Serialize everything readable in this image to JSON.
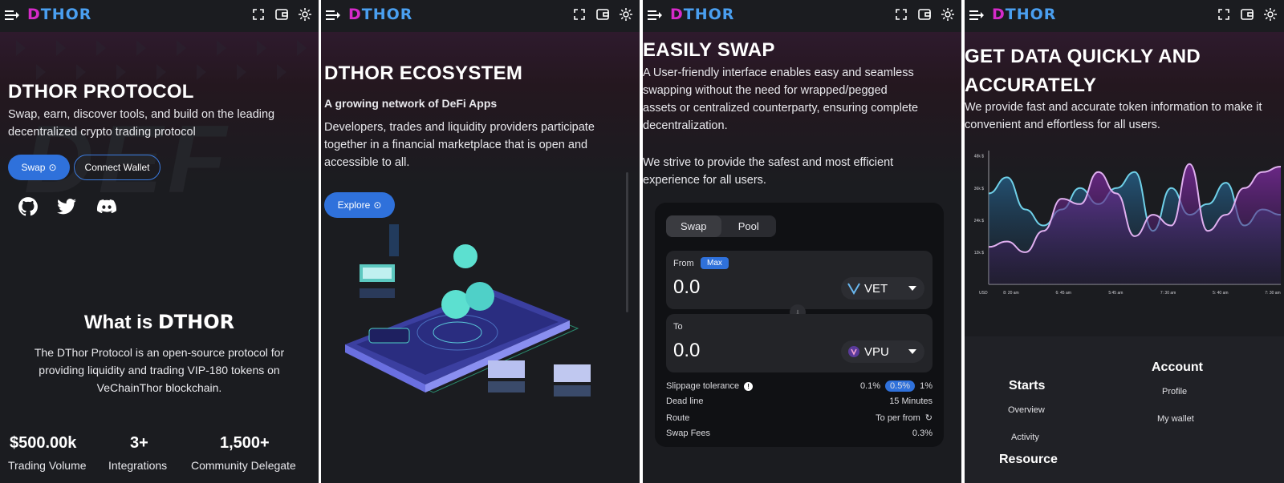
{
  "colors": {
    "bg": "#1b1c20",
    "accent": "#2f71db",
    "logo_blue": "#4a9ff0",
    "logo_pink": "#d62ac9",
    "chart_cyan": "#6fd0e8",
    "chart_purple": "#c26ad9"
  },
  "header": {
    "logo": "DTHOR",
    "logo_initial": "D",
    "logo_rest": "THOR",
    "icons": [
      "menu-icon",
      "fullscreen-icon",
      "wallet-icon",
      "gear-icon"
    ]
  },
  "panel1": {
    "title": "DTHOR PROTOCOL",
    "subtitle": "Swap, earn, discover tools, and build on the leading decentralized crypto trading protocol",
    "bg_word": "DEF",
    "swap_button": "Swap",
    "connect_button": "Connect Wallet",
    "social_icons": [
      "github-icon",
      "twitter-icon",
      "discord-icon"
    ],
    "what_is": "What is",
    "what_is_logo": "DTHOR",
    "description": "The DThor Protocol is an open-source protocol for providing liquidity and trading VIP-180 tokens on VeChainThor blockchain.",
    "stats": [
      {
        "value": "$500.00k",
        "label": "Trading Volume"
      },
      {
        "value": "3+",
        "label": "Integrations"
      },
      {
        "value": "1,500+",
        "label": "Community Delegate"
      }
    ]
  },
  "panel2": {
    "title": "DTHOR ECOSYSTEM",
    "subtitle": "A growing network of DeFi Apps",
    "text": "Developers, trades and liquidity providers participate together in a financial marketplace that is open and accessible to all.",
    "explore_button": "Explore"
  },
  "panel3": {
    "title": "EASILY SWAP",
    "text1": "A User-friendly interface enables easy and seamless swapping without the need for wrapped/pegged assets or centralized counterparty, ensuring complete decentralization.",
    "text2": "We strive to provide the safest and most efficient experience for all users.",
    "swap_card": {
      "tabs": [
        "Swap",
        "Pool"
      ],
      "from_label": "From",
      "max_label": "Max",
      "from_value": "0.0",
      "from_token": "VET",
      "to_label": "To",
      "to_value": "0.0",
      "to_token": "VPU",
      "slippage_label": "Slippage tolerance",
      "slippage_options": [
        "0.1%",
        "0.5%",
        "1%"
      ],
      "slippage_selected": "0.5%",
      "deadline_label": "Dead line",
      "deadline_value": "15 Minutes",
      "route_label": "Route",
      "route_value": "To per from",
      "fees_label": "Swap Fees",
      "fees_value": "0.3%"
    }
  },
  "panel4": {
    "title": "GET DATA QUICKLY AND ACCURATELY",
    "text": "We provide fast and accurate token information to make it convenient and effortless for all users.",
    "footer": {
      "starts_heading": "Starts",
      "starts_links": [
        "Overview",
        "Activity"
      ],
      "account_heading": "Account",
      "account_links": [
        "Profile",
        "My wallet"
      ],
      "resource_heading": "Resource"
    }
  },
  "chart_data": {
    "type": "area",
    "x": [
      "8: 20 am",
      "6: 45 am",
      "5:45 am",
      "7: 30 am",
      "5: 40 am",
      "7: 30 am"
    ],
    "y_ticks": [
      "12k $",
      "24k $",
      "36k $",
      "48k $"
    ],
    "ylabel": "USD",
    "ylim": [
      0,
      50
    ],
    "grid": false,
    "series": [
      {
        "values": [
          34,
          40,
          28,
          22,
          28,
          36,
          30,
          36,
          42,
          20,
          36,
          26,
          30,
          38,
          22,
          28,
          26
        ]
      },
      {
        "values": [
          14,
          16,
          12,
          20,
          32,
          30,
          42,
          34,
          18,
          26,
          22,
          45,
          20,
          26,
          36,
          42,
          44
        ]
      }
    ]
  }
}
